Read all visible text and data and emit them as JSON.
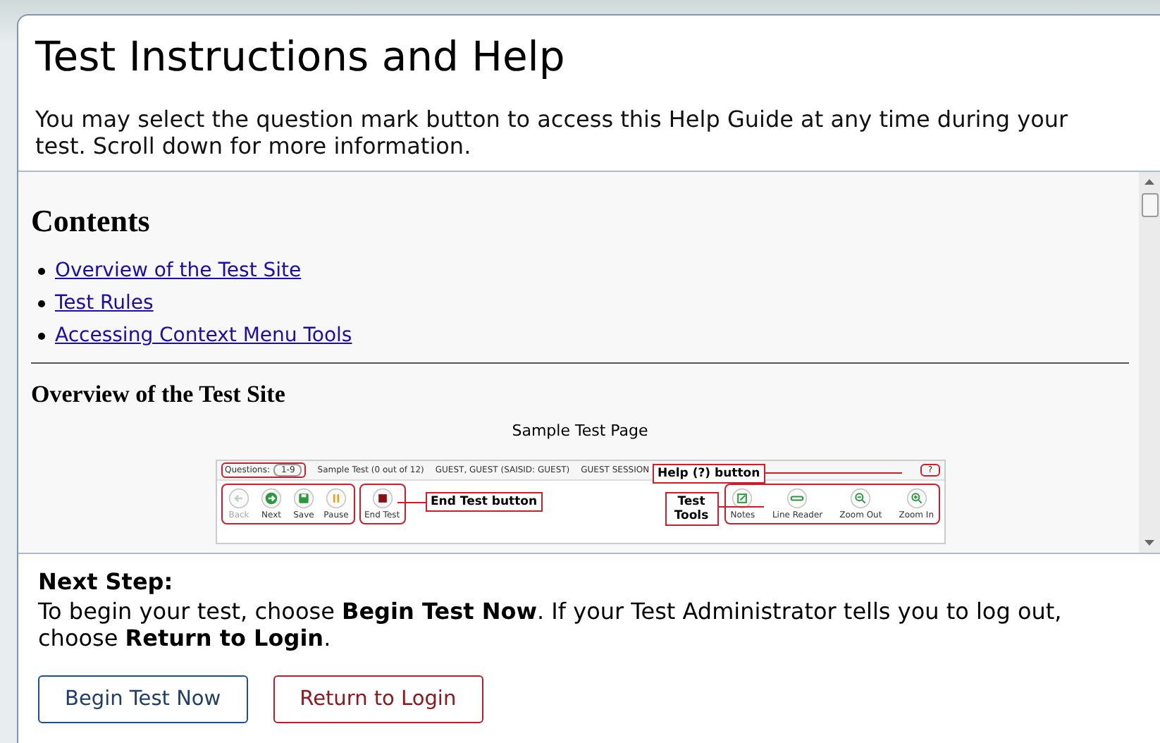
{
  "title": "Test Instructions and Help",
  "intro": "You may select the question mark button to access this Help Guide at any time during your test. Scroll down for more information.",
  "contents": {
    "heading": "Contents",
    "links": [
      "Overview of the Test Site",
      "Test Rules",
      "Accessing Context Menu Tools"
    ]
  },
  "section": {
    "heading": "Overview of the Test Site",
    "caption": "Sample Test Page",
    "sample": {
      "questions_label": "Questions:",
      "questions_value": "1-9",
      "test_name": "Sample Test (0 out of 12)",
      "user": "GUEST, GUEST (SAISID: GUEST)",
      "session": "GUEST SESSION",
      "help": "?",
      "buttons": [
        {
          "kind": "back",
          "label": "Back",
          "disabled": true
        },
        {
          "kind": "next",
          "label": "Next",
          "disabled": false
        },
        {
          "kind": "save",
          "label": "Save",
          "disabled": false
        },
        {
          "kind": "pause",
          "label": "Pause",
          "disabled": false
        }
      ],
      "end_button": {
        "kind": "end",
        "label": "End Test",
        "disabled": false
      },
      "tools": [
        {
          "kind": "notes",
          "label": "Notes"
        },
        {
          "kind": "line-reader",
          "label": "Line Reader"
        },
        {
          "kind": "zoom-out",
          "label": "Zoom Out"
        },
        {
          "kind": "zoom-in",
          "label": "Zoom In"
        }
      ],
      "callouts": [
        "Help (?) button",
        "End Test button",
        "Test Tools"
      ]
    }
  },
  "next_step": {
    "heading": "Next Step:",
    "text": "To begin your test, choose **Begin Test Now**. If your Test Administrator tells you to log out, choose **Return to Login**.",
    "buttons": [
      {
        "label": "Begin Test Now",
        "kind": "primary"
      },
      {
        "label": "Return to Login",
        "kind": "danger"
      }
    ]
  }
}
